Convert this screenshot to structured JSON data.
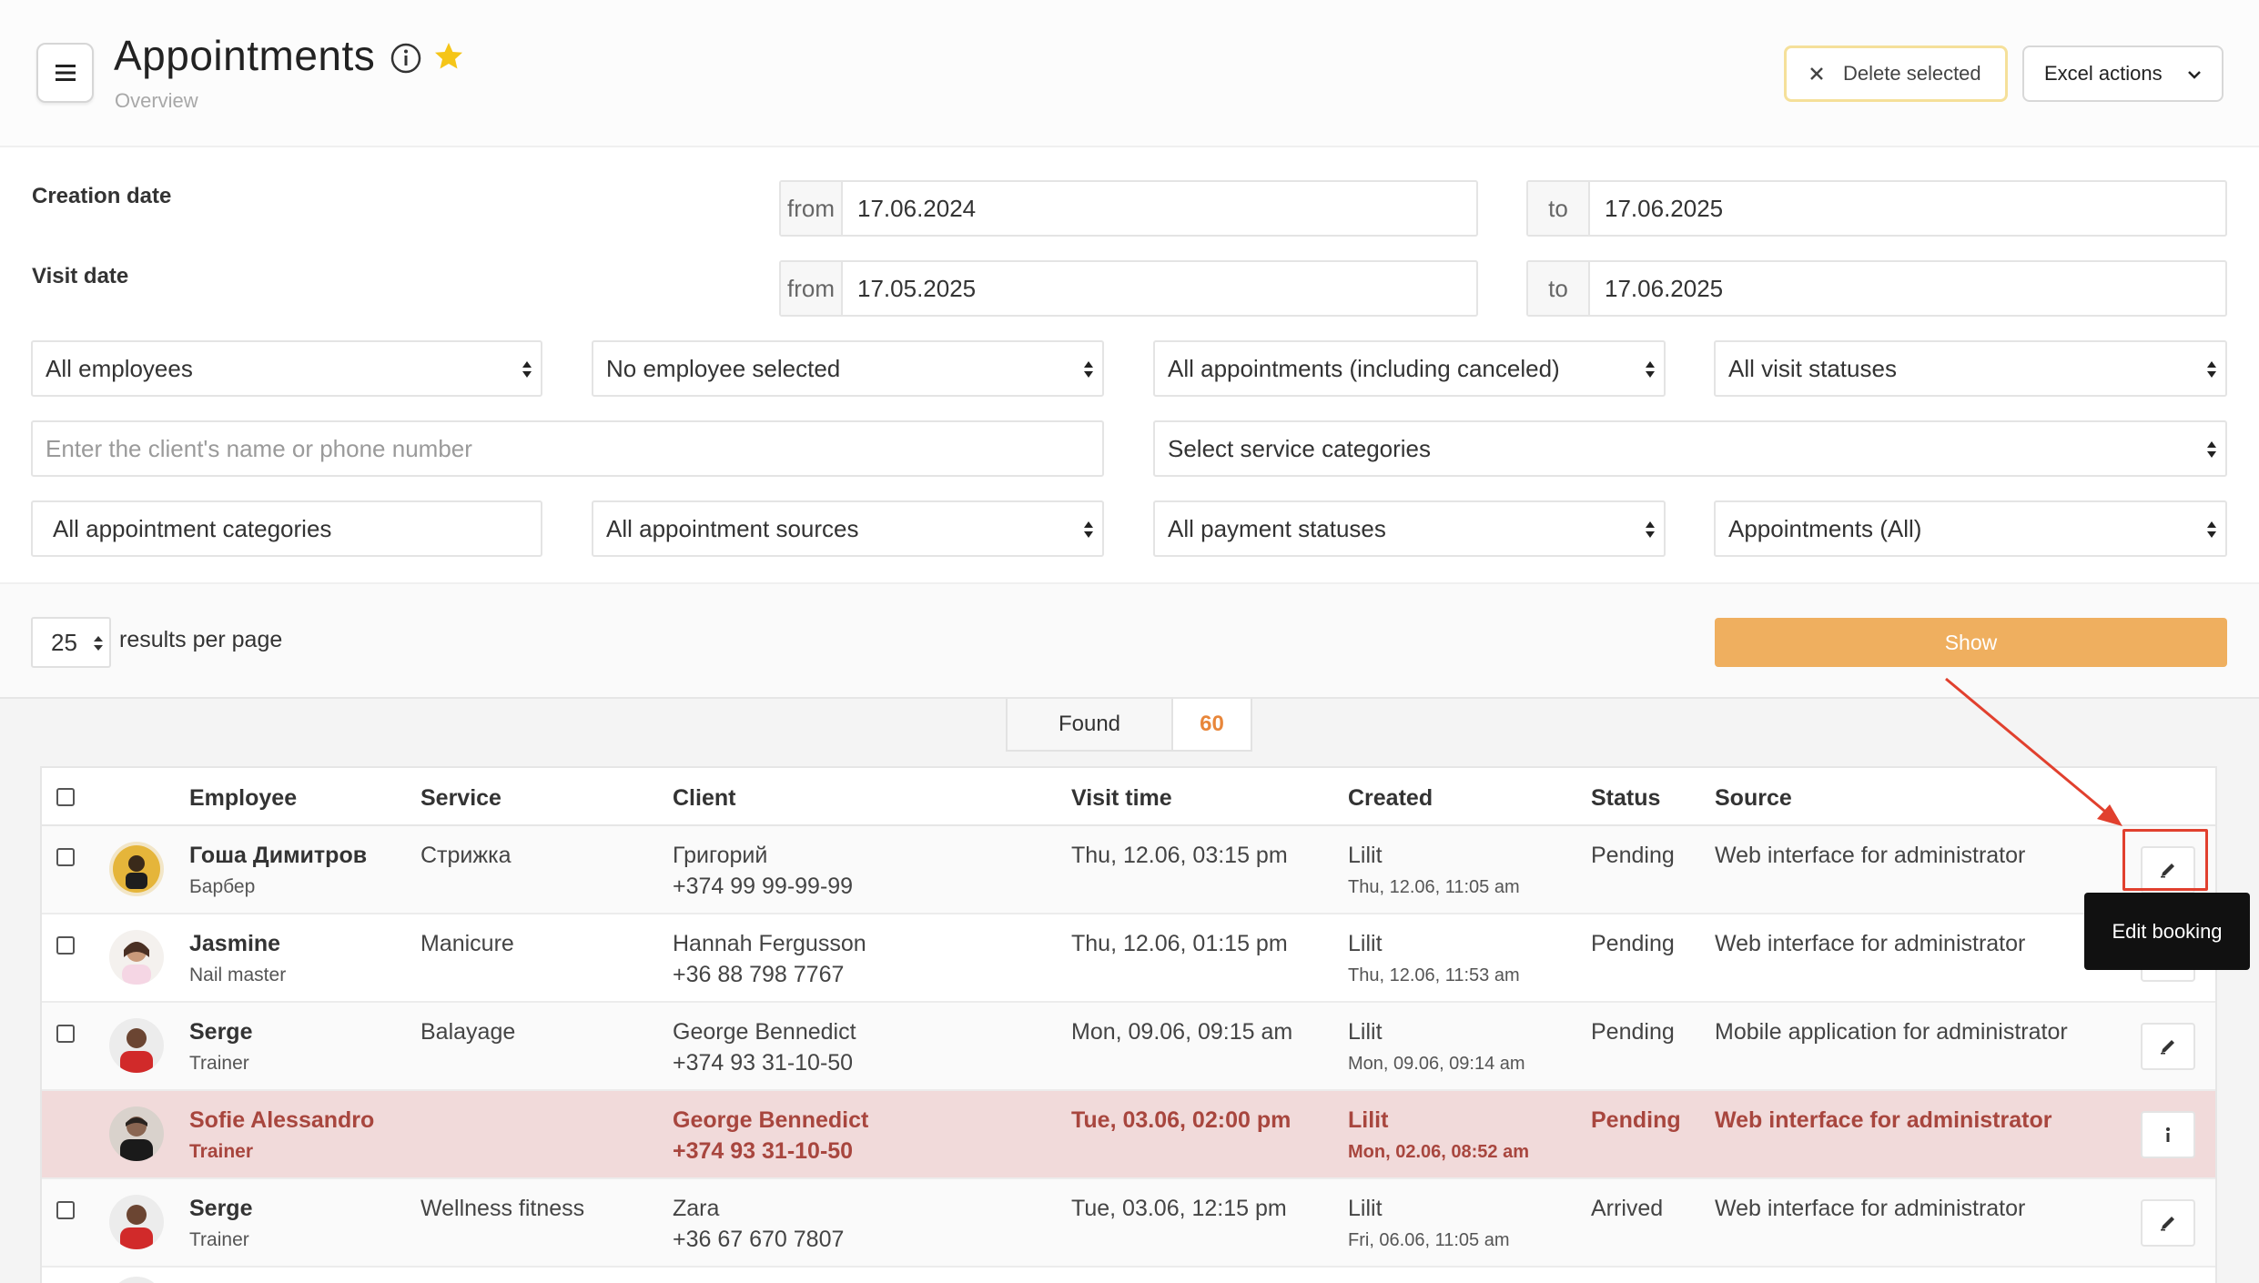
{
  "header": {
    "title": "Appointments",
    "subtitle": "Overview",
    "delete_label": "Delete selected",
    "excel_label": "Excel actions"
  },
  "filters": {
    "creation_date": {
      "label": "Creation date",
      "from_prefix": "from",
      "from": "17.06.2024",
      "to_prefix": "to",
      "to": "17.06.2025"
    },
    "visit_date": {
      "label": "Visit date",
      "from_prefix": "from",
      "from": "17.05.2025",
      "to_prefix": "to",
      "to": "17.06.2025"
    },
    "employees": "All employees",
    "employee_selected": "No employee selected",
    "appointments_scope": "All appointments (including canceled)",
    "visit_statuses": "All visit statuses",
    "client_search_placeholder": "Enter the client's name or phone number",
    "service_categories": "Select service categories",
    "appointment_categories": "All appointment categories",
    "appointment_sources": "All appointment sources",
    "payment_statuses": "All payment statuses",
    "appointments_type": "Appointments (All)"
  },
  "pager": {
    "per_page": "25",
    "per_page_label": "results per page",
    "show_label": "Show"
  },
  "results": {
    "found_label": "Found",
    "found_count": "60",
    "columns": [
      "Employee",
      "Service",
      "Client",
      "Visit time",
      "Created",
      "Status",
      "Source"
    ],
    "rows": [
      {
        "employee": "Гоша Димитров",
        "role": "Барбер",
        "service": "Стрижка",
        "client": "Григорий",
        "phone": "+374 99 99-99-99",
        "visit": "Thu, 12.06, 03:15 pm",
        "creator": "Lilit",
        "created_at": "Thu, 12.06, 11:05 am",
        "status": "Pending",
        "source": "Web interface for administrator"
      },
      {
        "employee": "Jasmine",
        "role": "Nail master",
        "service": "Manicure",
        "client": "Hannah Fergusson",
        "phone": "+36 88 798 7767",
        "visit": "Thu, 12.06, 01:15 pm",
        "creator": "Lilit",
        "created_at": "Thu, 12.06, 11:53 am",
        "status": "Pending",
        "source": "Web interface for administrator"
      },
      {
        "employee": "Serge",
        "role": "Trainer",
        "service": "Balayage",
        "client": "George Bennedict",
        "phone": "+374 93 31-10-50",
        "visit": "Mon, 09.06, 09:15 am",
        "creator": "Lilit",
        "created_at": "Mon, 09.06, 09:14 am",
        "status": "Pending",
        "source": "Mobile application for administrator"
      },
      {
        "employee": "Sofie Alessandro",
        "role": "Trainer",
        "service": "",
        "client": "George Bennedict",
        "phone": "+374 93 31-10-50",
        "visit": "Tue, 03.06, 02:00 pm",
        "creator": "Lilit",
        "created_at": "Mon, 02.06, 08:52 am",
        "status": "Pending",
        "source": "Web interface for administrator"
      },
      {
        "employee": "Serge",
        "role": "Trainer",
        "service": "Wellness fitness",
        "client": "Zara",
        "phone": "+36 67 670 7807",
        "visit": "Tue, 03.06, 12:15 pm",
        "creator": "Lilit",
        "created_at": "Fri, 06.06, 11:05 am",
        "status": "Arrived",
        "source": "Web interface for administrator"
      }
    ]
  },
  "tooltip": {
    "text": "Edit booking"
  },
  "colors": {
    "accent": "#efaf5f",
    "found_count": "#e8863a",
    "canceled_row_bg": "#f1dada",
    "canceled_text": "#a8463e",
    "annotation": "#e1402e"
  },
  "icons": {
    "menu": "hamburger-icon",
    "info": "info-circle-icon",
    "favorite": "star-icon",
    "delete": "close-icon",
    "excel_dropdown": "chevron-down-icon",
    "edit": "pencil-icon",
    "details": "info-icon"
  }
}
